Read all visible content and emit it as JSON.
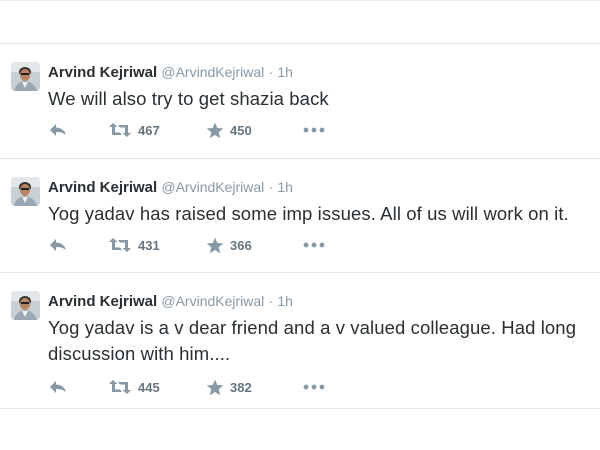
{
  "tweets": [
    {
      "fullname": "Arvind Kejriwal",
      "username": "@ArvindKejriwal",
      "separator": "·",
      "time": "1h",
      "text": "We will also try to get shazia back",
      "retweets": "467",
      "favorites": "450"
    },
    {
      "fullname": "Arvind Kejriwal",
      "username": "@ArvindKejriwal",
      "separator": "·",
      "time": "1h",
      "text": "Yog yadav has raised some imp issues. All of us will work on it.",
      "retweets": "431",
      "favorites": "366"
    },
    {
      "fullname": "Arvind Kejriwal",
      "username": "@ArvindKejriwal",
      "separator": "·",
      "time": "1h",
      "text": "Yog yadav is a v dear friend and a v valued colleague. Had long discussion with him....",
      "retweets": "445",
      "favorites": "382"
    }
  ],
  "icons": {
    "reply": "reply-icon",
    "retweet": "retweet-icon",
    "favorite": "star-icon",
    "more": "more-icon"
  },
  "colors": {
    "text": "#292f33",
    "secondary": "#8899a6",
    "divider": "#e1e8ed"
  }
}
